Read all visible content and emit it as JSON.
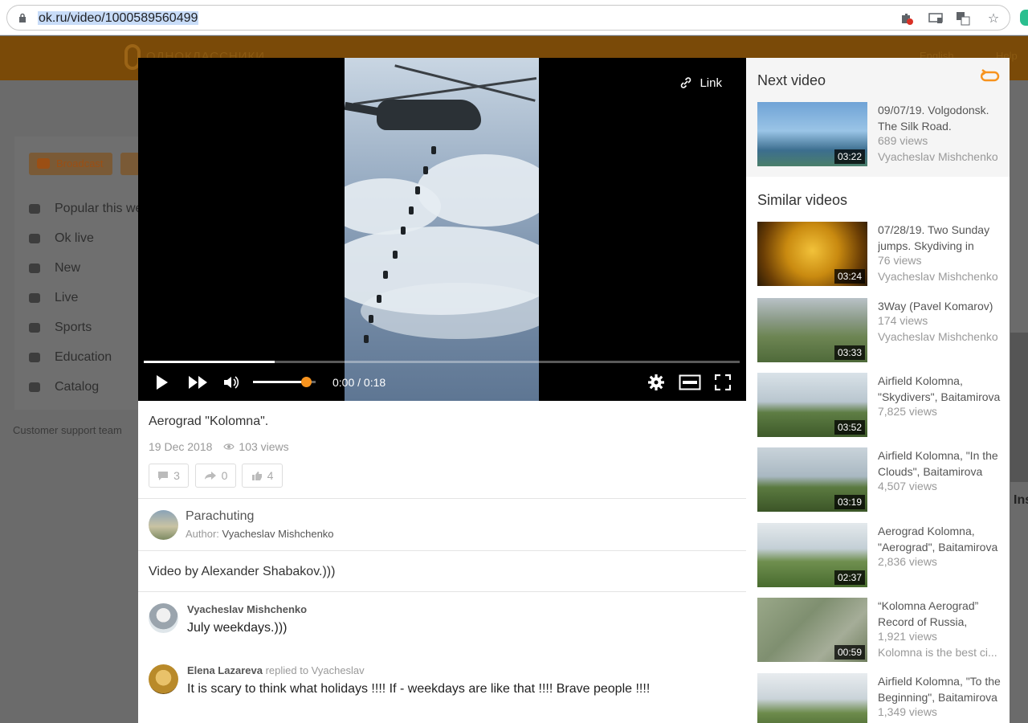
{
  "browser": {
    "url": "ok.ru/video/1000589560499",
    "icons": [
      "puzzle-blocked-icon",
      "cast-icon",
      "translate-icon",
      "star-icon"
    ]
  },
  "background": {
    "logo_text": "ОДНОКЛАССНИКИ",
    "header_links": [
      "English",
      "Help"
    ],
    "broadcast_label": "Broadcast",
    "menu": [
      {
        "label": "Popular this week",
        "icon": "fire-icon"
      },
      {
        "label": "Ok live",
        "icon": "ok-live-icon"
      },
      {
        "label": "New",
        "icon": "new-icon"
      },
      {
        "label": "Live",
        "icon": "camera-icon"
      },
      {
        "label": "Sports",
        "icon": "sports-icon"
      },
      {
        "label": "Education",
        "icon": "graduation-cap-icon"
      },
      {
        "label": "Catalog",
        "icon": "catalog-icon"
      }
    ],
    "support": "Customer support team",
    "right_fragment": "Ins"
  },
  "player": {
    "link_label": "Link",
    "time": "0:00 / 0:18",
    "progress": 0.22,
    "volume": 0.85
  },
  "video": {
    "title": "Aerograd \"Kolomna\".",
    "date": "19 Dec 2018",
    "views": "103 views",
    "comments_count": "3",
    "shares_count": "0",
    "likes_count": "4",
    "group_name": "Parachuting",
    "author_label": "Author:",
    "author_name": "Vyacheslav Mishchenko",
    "description": "Video by Alexander Shabakov.)))"
  },
  "comments": [
    {
      "author": "Vyacheslav Mishchenko",
      "reply_to": "",
      "text": "July weekdays.)))"
    },
    {
      "author": "Elena Lazareva",
      "reply_to": "replied to Vyacheslav",
      "text": "It is scary to think what holidays !!!! If - weekdays are like that !!!! Brave people !!!!"
    }
  ],
  "sidebar": {
    "next_title": "Next video",
    "similar_title": "Similar videos",
    "next_video": {
      "title_lines": [
        "09/07/19. Volgodonsk.",
        "The Silk Road."
      ],
      "views": "689 views",
      "author": "Vyacheslav Mishchenko",
      "duration": "03:22"
    },
    "similar": [
      {
        "title_lines": [
          "07/28/19. Two Sunday",
          "jumps. Skydiving in"
        ],
        "views": "76 views",
        "author": "Vyacheslav Mishchenko",
        "duration": "03:24"
      },
      {
        "title_lines": [
          "3Way (Pavel Komarov)"
        ],
        "views": "174 views",
        "author": "Vyacheslav Mishchenko",
        "duration": "03:33"
      },
      {
        "title_lines": [
          "Airfield Kolomna,",
          "\"Skydivers\", Baitamirova"
        ],
        "views": "7,825 views",
        "author": "",
        "duration": "03:52"
      },
      {
        "title_lines": [
          "Airfield Kolomna, \"In the",
          "Clouds\", Baitamirova"
        ],
        "views": "4,507 views",
        "author": "",
        "duration": "03:19"
      },
      {
        "title_lines": [
          "Aerograd Kolomna,",
          "\"Aerograd\", Baitamirova"
        ],
        "views": "2,836 views",
        "author": "",
        "duration": "02:37"
      },
      {
        "title_lines": [
          "“Kolomna Aerograd”",
          "Record of Russia,"
        ],
        "views": "1,921 views",
        "author": "Kolomna is the best ci...",
        "duration": "00:59"
      },
      {
        "title_lines": [
          "Airfield Kolomna, \"To the",
          "Beginning\", Baitamirova"
        ],
        "views": "1,349 views",
        "author": "",
        "duration": ""
      }
    ]
  }
}
